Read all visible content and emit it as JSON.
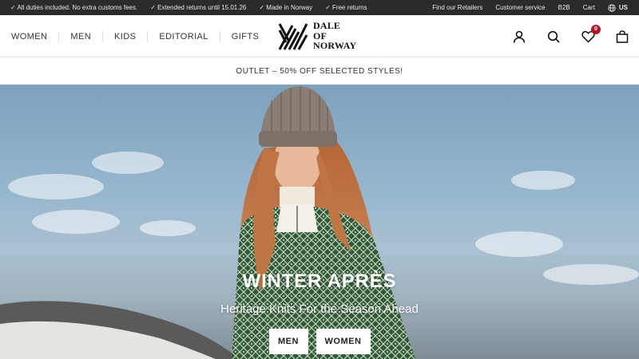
{
  "topbar": {
    "usps": [
      "✓  All duties included. No extra customs fees.",
      "✓  Extended returns until 15.01.26",
      "✓  Made in Norway",
      "✓  Free returns"
    ],
    "links": [
      "Find our Retailers",
      "Customer service",
      "B2B",
      "Cart"
    ],
    "locale": "US"
  },
  "header": {
    "nav": [
      "WOMEN",
      "MEN",
      "KIDS",
      "EDITORIAL",
      "GIFTS"
    ],
    "logo_lines": [
      "DALE",
      "OF",
      "NORWAY"
    ],
    "wishlist_count": "0",
    "icons": [
      "account-icon",
      "search-icon",
      "wishlist-heart-icon",
      "shopping-bag-icon"
    ]
  },
  "promo": {
    "text": "OUTLET – 50% OFF SELECTED STYLES!"
  },
  "hero": {
    "title": "WINTER APRÈS",
    "subtitle": "Heritage Knits For the Season Ahead",
    "buttons": [
      "MEN",
      "WOMEN"
    ]
  },
  "colors": {
    "topbar_bg": "#2b2b2b",
    "badge": "#b3142a",
    "sweater": "#2f5a36"
  }
}
